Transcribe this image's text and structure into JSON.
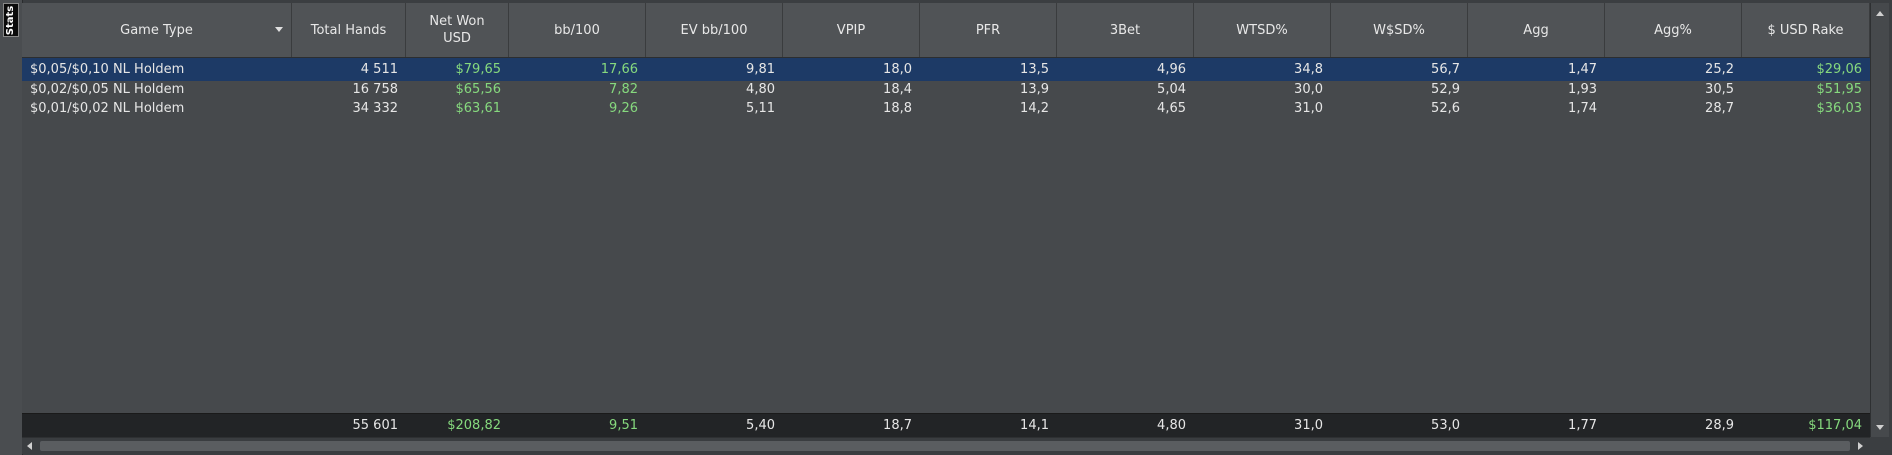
{
  "side_tab": {
    "label": "Stats"
  },
  "columns": [
    {
      "key": "game_type",
      "label": "Game Type"
    },
    {
      "key": "total_hands",
      "label": "Total Hands"
    },
    {
      "key": "net_won",
      "label": "Net Won\nUSD"
    },
    {
      "key": "bb100",
      "label": "bb/100"
    },
    {
      "key": "ev_bb100",
      "label": "EV bb/100"
    },
    {
      "key": "vpip",
      "label": "VPIP"
    },
    {
      "key": "pfr",
      "label": "PFR"
    },
    {
      "key": "three_bet",
      "label": "3Bet"
    },
    {
      "key": "wtsd",
      "label": "WTSD%"
    },
    {
      "key": "wsd",
      "label": "W$SD%"
    },
    {
      "key": "agg",
      "label": "Agg"
    },
    {
      "key": "agg_pct",
      "label": "Agg%"
    },
    {
      "key": "rake",
      "label": "$ USD Rake"
    }
  ],
  "rows": [
    {
      "game_type": "$0,05/$0,10 NL Holdem",
      "total_hands": "4 511",
      "net_won": "$79,65",
      "bb100": "17,66",
      "ev_bb100": "9,81",
      "vpip": "18,0",
      "pfr": "13,5",
      "three_bet": "4,96",
      "wtsd": "34,8",
      "wsd": "56,7",
      "agg": "1,47",
      "agg_pct": "25,2",
      "rake": "$29,06"
    },
    {
      "game_type": "$0,02/$0,05 NL Holdem",
      "total_hands": "16 758",
      "net_won": "$65,56",
      "bb100": "7,82",
      "ev_bb100": "4,80",
      "vpip": "18,4",
      "pfr": "13,9",
      "three_bet": "5,04",
      "wtsd": "30,0",
      "wsd": "52,9",
      "agg": "1,93",
      "agg_pct": "30,5",
      "rake": "$51,95"
    },
    {
      "game_type": "$0,01/$0,02 NL Holdem",
      "total_hands": "34 332",
      "net_won": "$63,61",
      "bb100": "9,26",
      "ev_bb100": "5,11",
      "vpip": "18,8",
      "pfr": "14,2",
      "three_bet": "4,65",
      "wtsd": "31,0",
      "wsd": "52,6",
      "agg": "1,74",
      "agg_pct": "28,7",
      "rake": "$36,03"
    }
  ],
  "totals": {
    "game_type": "",
    "total_hands": "55 601",
    "net_won": "$208,82",
    "bb100": "9,51",
    "ev_bb100": "5,40",
    "vpip": "18,7",
    "pfr": "14,1",
    "three_bet": "4,80",
    "wtsd": "31,0",
    "wsd": "53,0",
    "agg": "1,77",
    "agg_pct": "28,9",
    "rake": "$117,04"
  },
  "colors": {
    "positive": "#86d97e",
    "selected_row": "#1d3a66"
  },
  "green_columns": [
    "net_won",
    "bb100",
    "rake"
  ],
  "selected_row_index": 0,
  "icons": {
    "sort_dropdown": "chevron-down-icon",
    "scroll_up": "scroll-up-arrow-icon",
    "scroll_down": "scroll-down-arrow-icon",
    "scroll_left": "scroll-left-arrow-icon",
    "scroll_right": "scroll-right-arrow-icon"
  }
}
